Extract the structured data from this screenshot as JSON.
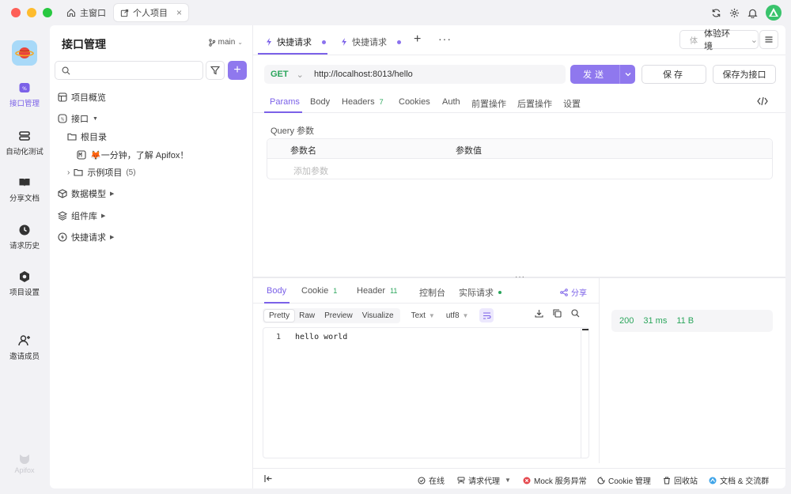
{
  "titlebar": {
    "tabs": [
      {
        "label": "主窗口",
        "icon": "home-icon"
      },
      {
        "label": "个人项目",
        "icon": "external-link-icon"
      }
    ]
  },
  "rail": {
    "items": [
      {
        "label": "接口管理",
        "icon": "api-icon",
        "active": true
      },
      {
        "label": "自动化测试",
        "icon": "test-icon"
      },
      {
        "label": "分享文档",
        "icon": "book-icon"
      },
      {
        "label": "请求历史",
        "icon": "clock-icon"
      },
      {
        "label": "项目设置",
        "icon": "settings-icon"
      },
      {
        "label": "邀请成员",
        "icon": "invite-user-icon"
      }
    ],
    "brand": "Apifox"
  },
  "tree": {
    "title": "接口管理",
    "branch": "main",
    "search": {
      "placeholder": "",
      "value": ""
    },
    "nodes": {
      "overview": "项目概览",
      "api": "接口",
      "root": "根目录",
      "intro": "🦊一分钟，了解 Apifox！",
      "example": "示例项目",
      "example_count": "(5)",
      "models": "数据模型",
      "components": "组件库",
      "quick": "快捷请求"
    }
  },
  "request_tabs": {
    "tabs": [
      {
        "label": "快捷请求",
        "active": true
      },
      {
        "label": "快捷请求",
        "active": false
      }
    ],
    "env_badge": "体",
    "env": "体验环境"
  },
  "request": {
    "method": "GET",
    "url": "http://localhost:8013/hello",
    "send": "发送",
    "save": "保存",
    "save_as": "保存为接口"
  },
  "param_tabs": {
    "params": "Params",
    "body": "Body",
    "headers": "Headers",
    "headers_count": "7",
    "cookies": "Cookies",
    "auth": "Auth",
    "pre": "前置操作",
    "post": "后置操作",
    "settings": "设置"
  },
  "query": {
    "title": "Query 参数",
    "col_name": "参数名",
    "col_value": "参数值",
    "add_placeholder": "添加参数"
  },
  "response_tabs": {
    "body": "Body",
    "cookie": "Cookie",
    "cookie_count": "1",
    "header": "Header",
    "header_count": "11",
    "console": "控制台",
    "actual": "实际请求",
    "share": "分享"
  },
  "viewbar": {
    "modes": [
      "Pretty",
      "Raw",
      "Preview",
      "Visualize"
    ],
    "format": "Text",
    "encoding": "utf8"
  },
  "response": {
    "line_number": "1",
    "body": "hello world",
    "status": "200",
    "time": "31 ms",
    "size": "11 B"
  },
  "statusbar": {
    "online": "在线",
    "proxy": "请求代理",
    "mock": "Mock 服务异常",
    "cookie": "Cookie 管理",
    "trash": "回收站",
    "docs": "文档 & 交流群"
  },
  "colors": {
    "accent": "#7b61e8",
    "button": "#8f78ee",
    "success": "#2aa55b",
    "error": "#e5484d"
  }
}
